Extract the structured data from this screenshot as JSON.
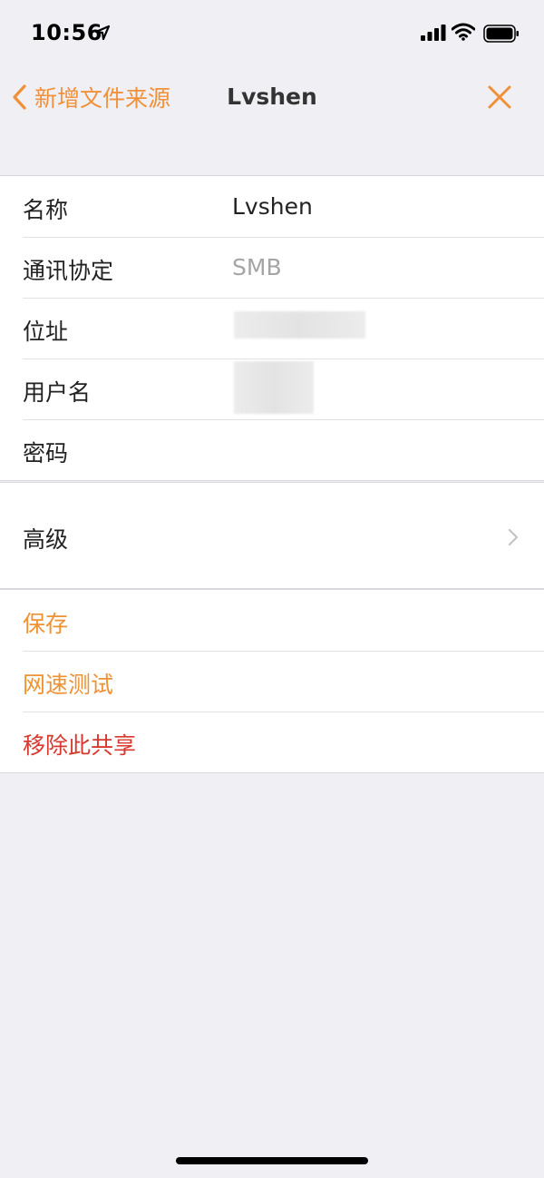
{
  "status_bar": {
    "time": "10:56"
  },
  "nav": {
    "back_label": "新增文件来源",
    "title": "Lvshen"
  },
  "form": {
    "rows": [
      {
        "label": "名称",
        "value": "Lvshen"
      },
      {
        "label": "通讯协定",
        "value": "SMB"
      },
      {
        "label": "位址",
        "value": ""
      },
      {
        "label": "用户名",
        "value": ""
      },
      {
        "label": "密码",
        "value": ""
      }
    ]
  },
  "advanced": {
    "label": "高级"
  },
  "actions": {
    "save": "保存",
    "speed_test": "网速测试",
    "remove_share": "移除此共享"
  },
  "colors": {
    "accent": "#f0913a",
    "destructive": "#d8392e",
    "background": "#efeff4"
  }
}
